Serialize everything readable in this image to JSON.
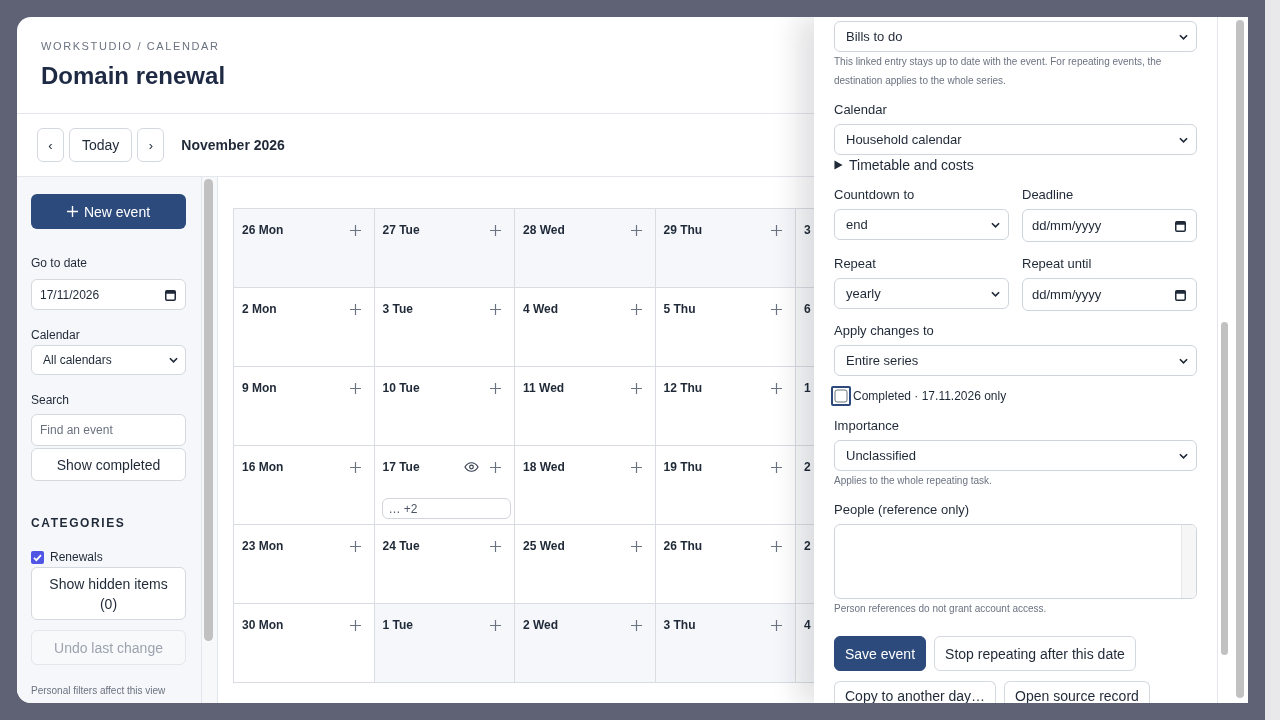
{
  "header": {
    "breadcrumb": "WORKSTUDIO / CALENDAR",
    "title": "Domain renewal"
  },
  "toolbar": {
    "prev": "‹",
    "today": "Today",
    "next": "›",
    "month": "November 2026"
  },
  "sidebar": {
    "new_event": "New event",
    "go_to_date": {
      "label": "Go to date",
      "value": "17/11/2026"
    },
    "calendar": {
      "label": "Calendar",
      "value": "All calendars"
    },
    "search": {
      "label": "Search",
      "placeholder": "Find an event"
    },
    "show_completed": "Show completed",
    "categories": {
      "title": "CATEGORIES",
      "items": [
        {
          "label": "Renewals",
          "checked": true
        }
      ]
    },
    "show_hidden": "Show hidden items (0)",
    "undo": {
      "label": "Undo last change",
      "disabled": true
    },
    "note": "Personal filters affect this view"
  },
  "calendar": {
    "weeks": [
      {
        "days": [
          {
            "kind": "day",
            "label": "26 Mon",
            "in_month": false,
            "eye_button": false
          },
          {
            "kind": "day",
            "label": "27 Tue",
            "in_month": false,
            "eye_button": false
          },
          {
            "kind": "day",
            "label": "28 Wed",
            "in_month": false,
            "eye_button": false
          },
          {
            "kind": "day",
            "label": "29 Thu",
            "in_month": false,
            "eye_button": false
          },
          {
            "kind": "partial",
            "label": "3"
          }
        ]
      },
      {
        "days": [
          {
            "kind": "day",
            "label": "2 Mon",
            "in_month": true,
            "eye_button": false
          },
          {
            "kind": "day",
            "label": "3 Tue",
            "in_month": true,
            "eye_button": false
          },
          {
            "kind": "day",
            "label": "4 Wed",
            "in_month": true,
            "eye_button": false
          },
          {
            "kind": "day",
            "label": "5 Thu",
            "in_month": true,
            "eye_button": false
          },
          {
            "kind": "partial",
            "label": "6"
          }
        ]
      },
      {
        "days": [
          {
            "kind": "day",
            "label": "9 Mon",
            "in_month": true,
            "eye_button": false
          },
          {
            "kind": "day",
            "label": "10 Tue",
            "in_month": true,
            "eye_button": false
          },
          {
            "kind": "day",
            "label": "11 Wed",
            "in_month": true,
            "eye_button": false
          },
          {
            "kind": "day",
            "label": "12 Thu",
            "in_month": true,
            "eye_button": false
          },
          {
            "kind": "partial",
            "label": "1"
          }
        ]
      },
      {
        "days": [
          {
            "kind": "day",
            "label": "16 Mon",
            "in_month": true,
            "eye_button": false
          },
          {
            "kind": "day",
            "label": "17 Tue",
            "in_month": true,
            "eye_button": true,
            "more": "… +2"
          },
          {
            "kind": "day",
            "label": "18 Wed",
            "in_month": true,
            "eye_button": false
          },
          {
            "kind": "day",
            "label": "19 Thu",
            "in_month": true,
            "eye_button": false
          },
          {
            "kind": "partial",
            "label": "2"
          }
        ]
      },
      {
        "days": [
          {
            "kind": "day",
            "label": "23 Mon",
            "in_month": true,
            "eye_button": false
          },
          {
            "kind": "day",
            "label": "24 Tue",
            "in_month": true,
            "eye_button": false
          },
          {
            "kind": "day",
            "label": "25 Wed",
            "in_month": true,
            "eye_button": false
          },
          {
            "kind": "day",
            "label": "26 Thu",
            "in_month": true,
            "eye_button": false
          },
          {
            "kind": "partial",
            "label": "2"
          }
        ]
      },
      {
        "days": [
          {
            "kind": "day",
            "label": "30 Mon",
            "in_month": true,
            "eye_button": false
          },
          {
            "kind": "day",
            "label": "1 Tue",
            "in_month": false,
            "eye_button": false
          },
          {
            "kind": "day",
            "label": "2 Wed",
            "in_month": false,
            "eye_button": false
          },
          {
            "kind": "day",
            "label": "3 Thu",
            "in_month": false,
            "eye_button": false
          },
          {
            "kind": "partial",
            "label": "4"
          }
        ]
      }
    ]
  },
  "editor": {
    "fields": [
      {
        "kind": "select",
        "value": "Bills to do"
      },
      {
        "kind": "hint",
        "text": "This linked entry stays up to date with the event. For repeating events, the destination applies to the whole series."
      },
      {
        "kind": "select",
        "label": "Calendar",
        "value": "Household calendar"
      },
      {
        "kind": "details",
        "label": "Timetable and costs",
        "expanded": false
      },
      {
        "kind": "pair",
        "items": [
          {
            "kind": "select",
            "label": "Countdown to",
            "value": "end"
          },
          {
            "kind": "date",
            "label": "Deadline",
            "placeholder": "dd/mm/yyyy"
          }
        ]
      },
      {
        "kind": "pair",
        "items": [
          {
            "kind": "select",
            "label": "Repeat",
            "value": "yearly"
          },
          {
            "kind": "date",
            "label": "Repeat until",
            "placeholder": "dd/mm/yyyy"
          }
        ]
      },
      {
        "kind": "select",
        "label": "Apply changes to",
        "value": "Entire series"
      },
      {
        "kind": "checkbox",
        "label": "Completed · 17.11.2026 only",
        "checked": false,
        "focused": true
      },
      {
        "kind": "select",
        "label": "Importance",
        "value": "Unclassified"
      },
      {
        "kind": "hint",
        "text": "Applies to the whole repeating task."
      },
      {
        "kind": "textarea",
        "label": "People (reference only)"
      },
      {
        "kind": "hint",
        "text": "Person references do not grant account access."
      }
    ],
    "buttons": [
      {
        "label": "Save event",
        "primary": true
      },
      {
        "label": "Stop repeating after this date",
        "primary": false
      },
      {
        "label": "Copy to another day…",
        "primary": false
      },
      {
        "label": "Open source record",
        "primary": false
      }
    ]
  }
}
